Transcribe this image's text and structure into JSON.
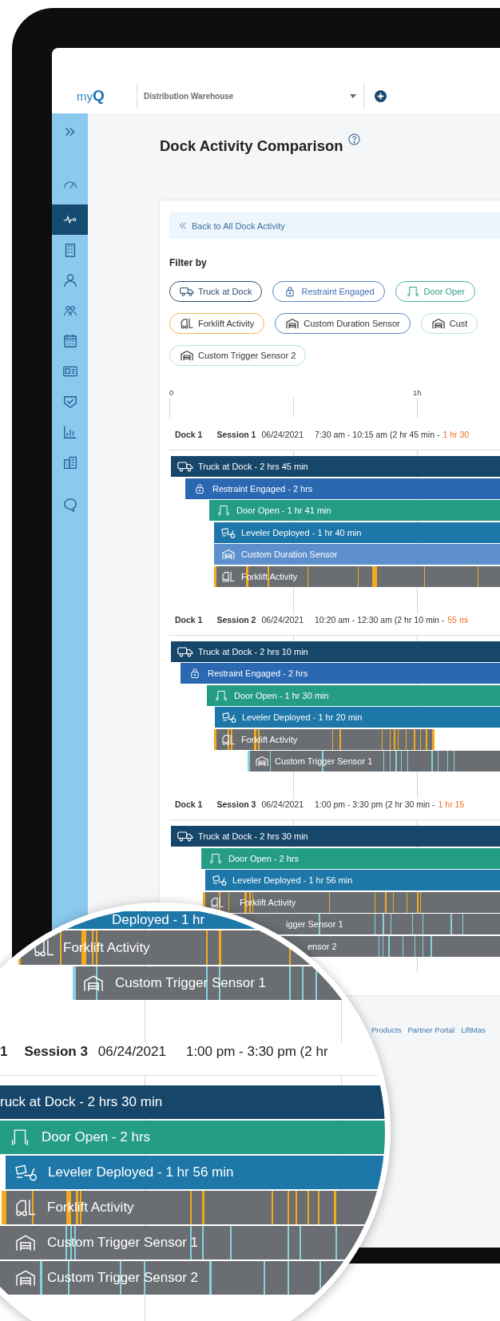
{
  "header": {
    "logo": "my**Q**",
    "location": "Distribution Warehouse"
  },
  "sidebar": {
    "items": [
      {
        "selected": false
      },
      {
        "selected": false
      },
      {
        "selected": true
      },
      {
        "selected": false
      },
      {
        "selected": false
      },
      {
        "selected": false
      },
      {
        "selected": false
      },
      {
        "selected": false
      },
      {
        "selected": false
      },
      {
        "selected": false
      },
      {
        "selected": false
      },
      {
        "selected": false
      }
    ]
  },
  "page": {
    "title": "Dock Activity Comparison",
    "back_link": "Back to All Dock Activity",
    "filter_label": "Filter by"
  },
  "filter_rows": [
    [
      {
        "kind": "truck",
        "label": "Truck at Dock"
      },
      {
        "kind": "restraint",
        "label": "Restraint Engaged"
      },
      {
        "kind": "door",
        "label": "Door Oper"
      }
    ],
    [
      {
        "kind": "forklift",
        "label": "Forklift Activity"
      },
      {
        "kind": "duration",
        "label": "Custom Duration Sensor"
      },
      {
        "kind": "trigger",
        "label": "Cust"
      }
    ],
    [
      {
        "kind": "trigger",
        "label": "Custom Trigger Sensor 2"
      }
    ]
  ],
  "axis": {
    "labels": [
      "0",
      "1h"
    ]
  },
  "sessions": [
    {
      "dock": "Dock 1",
      "session": "Session 1",
      "date": "06/24/2021",
      "time": "7:30 am - 10:15 am (2 hr 45 min -",
      "idle": "1 hr 30",
      "bars": [
        {
          "kind": "truck",
          "label": "Truck at Dock - 2 hrs 45 min"
        },
        {
          "kind": "restraint",
          "label": "Restraint Engaged - 2 hrs"
        },
        {
          "kind": "door",
          "label": "Door Open - 1 hr 41 min"
        },
        {
          "kind": "leveler",
          "label": "Leveler Deployed - 1 hr 40 min"
        },
        {
          "kind": "duration",
          "label": "Custom Duration Sensor"
        },
        {
          "kind": "forklift",
          "label": "Forklift Activity"
        }
      ]
    },
    {
      "dock": "Dock 1",
      "session": "Session 2",
      "date": "06/24/2021",
      "time": "10:20 am - 12:30 am (2 hr 10 min -",
      "idle": "55 mi",
      "bars": [
        {
          "kind": "truck",
          "label": "Truck at Dock - 2 hrs 10 min"
        },
        {
          "kind": "restraint",
          "label": "Restraint Engaged - 2 hrs"
        },
        {
          "kind": "door",
          "label": "Door Open - 1 hr 30 min"
        },
        {
          "kind": "leveler",
          "label": "Leveler Deployed - 1 hr 20 min"
        },
        {
          "kind": "forklift",
          "label": "Forklift Activity"
        },
        {
          "kind": "trigger",
          "label": "Custom Trigger Sensor 1"
        }
      ]
    },
    {
      "dock": "Dock 1",
      "session": "Session 3",
      "date": "06/24/2021",
      "time": "1:00 pm - 3:30 pm (2 hr 30 min -",
      "idle": "1 hr 15",
      "bars": [
        {
          "kind": "truck",
          "label": "Truck at Dock - 2 hrs 30 min"
        },
        {
          "kind": "door",
          "label": "Door Open - 2 hrs"
        },
        {
          "kind": "leveler",
          "label": "Leveler Deployed - 1 hr 56 min"
        },
        {
          "kind": "forklift",
          "label": "Forklift Activity"
        },
        {
          "kind": "trigger",
          "label": "igger Sensor 1"
        },
        {
          "kind": "trigger",
          "label": "ensor 2"
        }
      ]
    }
  ],
  "footer": {
    "links": [
      "Products",
      "Partner Portal",
      "LiftMas"
    ]
  },
  "magnifier": {
    "bars_top": [
      {
        "kind": "leveler",
        "label": "Deployed - 1 hr"
      },
      {
        "kind": "forklift",
        "label": "Forklift Activity"
      },
      {
        "kind": "trigger",
        "label": "Custom Trigger Sensor 1"
      }
    ],
    "session": {
      "dock": "1",
      "session": "Session 3",
      "date": "06/24/2021",
      "time": "1:00 pm - 3:30 pm (2 hr"
    },
    "bars": [
      {
        "kind": "truck",
        "label": "ruck at Dock - 2 hrs 30 min"
      },
      {
        "kind": "door",
        "label": "Door Open - 2 hrs"
      },
      {
        "kind": "leveler",
        "label": "Leveler Deployed - 1 hr 56 min"
      },
      {
        "kind": "forklift",
        "label": "Forklift Activity"
      },
      {
        "kind": "trigger",
        "label": "Custom Trigger Sensor 1"
      },
      {
        "kind": "trigger",
        "label": "Custom Trigger Sensor 2"
      }
    ]
  }
}
